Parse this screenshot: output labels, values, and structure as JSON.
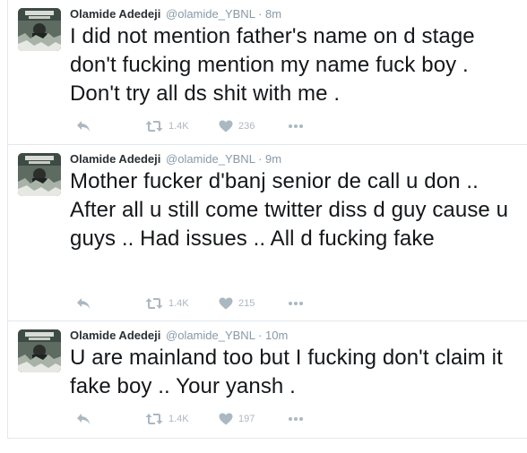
{
  "colors": {
    "name": "#292f33",
    "meta": "#8899a6",
    "text": "#14171a",
    "action": "#aab8c2",
    "divider": "#e1e8ed"
  },
  "tweets": [
    {
      "fullname": "Olamide Adedeji",
      "username": "@olamide_YBNL",
      "separator": "·",
      "time": "8m",
      "text": "I did not mention father's name on d stage don't fucking mention my name fuck boy . Don't try all ds shit with me .",
      "icons": {
        "reply": "reply-icon",
        "retweet": "retweet-icon",
        "like": "heart-icon",
        "more": "more-icon"
      },
      "retweets": "1.4K",
      "likes": "236"
    },
    {
      "fullname": "Olamide Adedeji",
      "username": "@olamide_YBNL",
      "separator": "·",
      "time": "9m",
      "text": "Mother fucker d'banj senior de call u don .. After all u still come twitter diss d guy cause u guys .. Had issues .. All d fucking fake",
      "icons": {
        "reply": "reply-icon",
        "retweet": "retweet-icon",
        "like": "heart-icon",
        "more": "more-icon"
      },
      "retweets": "1.4K",
      "likes": "215"
    },
    {
      "fullname": "Olamide Adedeji",
      "username": "@olamide_YBNL",
      "separator": "·",
      "time": "10m",
      "text": "U are mainland too but I fucking don't claim it fake boy .. Your yansh .",
      "icons": {
        "reply": "reply-icon",
        "retweet": "retweet-icon",
        "like": "heart-icon",
        "more": "more-icon"
      },
      "retweets": "1.4K",
      "likes": "197"
    }
  ]
}
